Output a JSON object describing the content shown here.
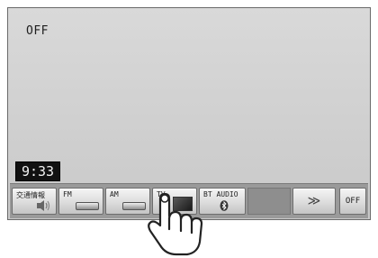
{
  "status": {
    "text": "OFF"
  },
  "clock": {
    "time": "9:33"
  },
  "sources": [
    {
      "label": "交通情報",
      "icon": "speaker-icon"
    },
    {
      "label": "FM",
      "icon": "bar-icon"
    },
    {
      "label": "AM",
      "icon": "bar-icon"
    },
    {
      "label": "TV",
      "icon": "tv-screen-icon"
    },
    {
      "label": "BT AUDIO",
      "icon": "bluetooth-icon"
    }
  ],
  "more": {
    "label": "≫"
  },
  "power": {
    "label": "OFF"
  },
  "gesture": {
    "icon": "touch-hand-icon"
  }
}
